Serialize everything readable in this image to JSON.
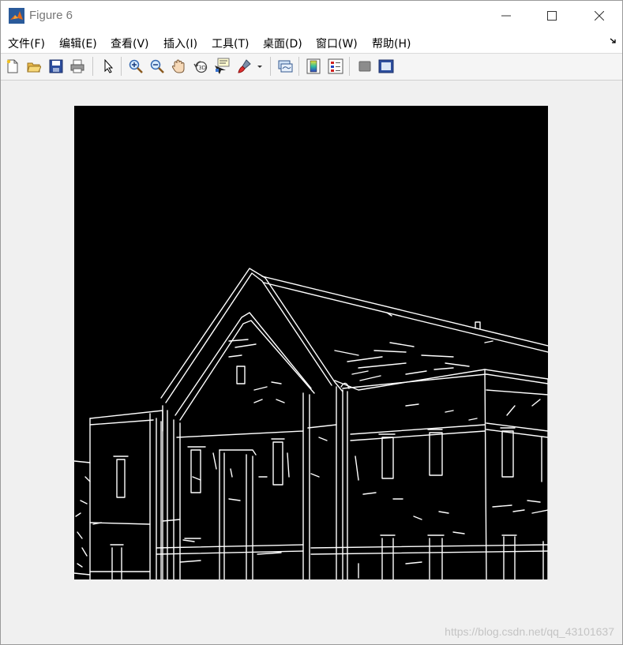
{
  "window": {
    "title": "Figure 6"
  },
  "menu": {
    "items": [
      {
        "id": "file",
        "label": "文件(F)"
      },
      {
        "id": "edit",
        "label": "编辑(E)"
      },
      {
        "id": "view",
        "label": "查看(V)"
      },
      {
        "id": "insert",
        "label": "插入(I)"
      },
      {
        "id": "tools",
        "label": "工具(T)"
      },
      {
        "id": "desktop",
        "label": "桌面(D)"
      },
      {
        "id": "window",
        "label": "窗口(W)"
      },
      {
        "id": "help",
        "label": "帮助(H)"
      }
    ]
  },
  "toolbar": {
    "icons": [
      "new-figure-icon",
      "open-file-icon",
      "save-icon",
      "print-icon",
      "select-arrow-icon",
      "zoom-in-icon",
      "zoom-out-icon",
      "pan-hand-icon",
      "rotate-3d-icon",
      "data-cursor-icon",
      "brush-icon",
      "link-plot-icon",
      "colorbar-icon",
      "legend-icon",
      "hide-plot-tools-icon",
      "show-plot-tools-icon"
    ]
  },
  "figure": {
    "image_description_colors": {
      "background": "#000000",
      "edges": "#ffffff"
    }
  },
  "watermark": "https://blog.csdn.net/qq_43101637"
}
